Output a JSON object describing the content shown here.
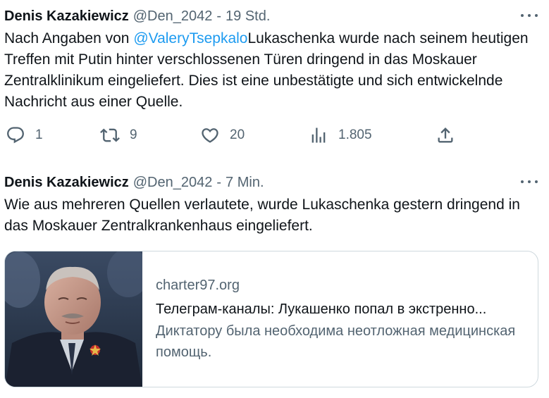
{
  "colors": {
    "text": "#0f1419",
    "secondary": "#536471",
    "link": "#1d9bf0",
    "border": "#cfd9de"
  },
  "tweets": [
    {
      "display_name": "Denis Kazakiewicz",
      "handle": "@Den_2042",
      "separator": "-",
      "time": "19 Std.",
      "text_before": "Nach Angaben von ",
      "mention": "@ValeryTsepkalo",
      "text_after": "Lukaschenka wurde nach seinem heutigen Treffen mit Putin hinter verschlossenen Türen dringend in das Moskauer Zentralklinikum eingeliefert. Dies ist eine unbestätigte und sich entwickelnde Nachricht aus einer Quelle.",
      "actions": {
        "reply_icon": "reply-icon",
        "reply_count": "1",
        "retweet_icon": "retweet-icon",
        "retweet_count": "9",
        "like_icon": "heart-icon",
        "like_count": "20",
        "views_icon": "views-bar-chart-icon",
        "views_count": "1.805",
        "share_icon": "share-icon"
      }
    },
    {
      "display_name": "Denis Kazakiewicz",
      "handle": "@Den_2042",
      "separator": "-",
      "time": "7 Min.",
      "text": "Wie aus mehreren Quellen verlautete, wurde Lukaschenka gestern dringend in das Moskauer Zentralkrankenhaus eingeliefert.",
      "card": {
        "domain": "charter97.org",
        "title": "Телеграм-каналы: Лукашенко попал в экстренно...",
        "description": "Диктатору была необходима неотложная медицинская помощь."
      }
    }
  ]
}
